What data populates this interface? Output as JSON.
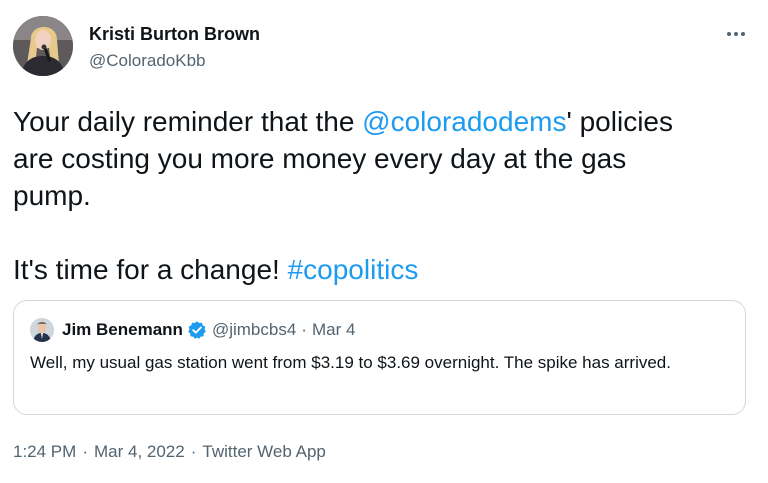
{
  "author": {
    "name": "Kristi Burton Brown",
    "handle": "@ColoradoKbb"
  },
  "more_icon": "more-horizontal-icon",
  "tweet": {
    "line1_prefix": "Your daily reminder that the ",
    "line1_mention": "@coloradodems",
    "line1_suffix": "' policies",
    "line2": "are costing you more money every day at the gas",
    "line3": "pump.",
    "line4_prefix": "It's time for a change! ",
    "line4_hashtag": "#copolitics"
  },
  "quote": {
    "name": "Jim Benemann",
    "verified_icon": "verified-badge-icon",
    "handle": "@jimbcbs4",
    "separator": "·",
    "date": "Mar 4",
    "text": "Well, my usual gas station went from $3.19 to $3.69 overnight. The spike has arrived."
  },
  "meta": {
    "time": "1:24 PM",
    "separator": "·",
    "date": "Mar 4, 2022",
    "app": "Twitter Web App"
  },
  "colors": {
    "link": "#1d9bf0",
    "secondary_text": "#536471",
    "border": "#cfd9de",
    "primary_text": "#0f1419"
  }
}
